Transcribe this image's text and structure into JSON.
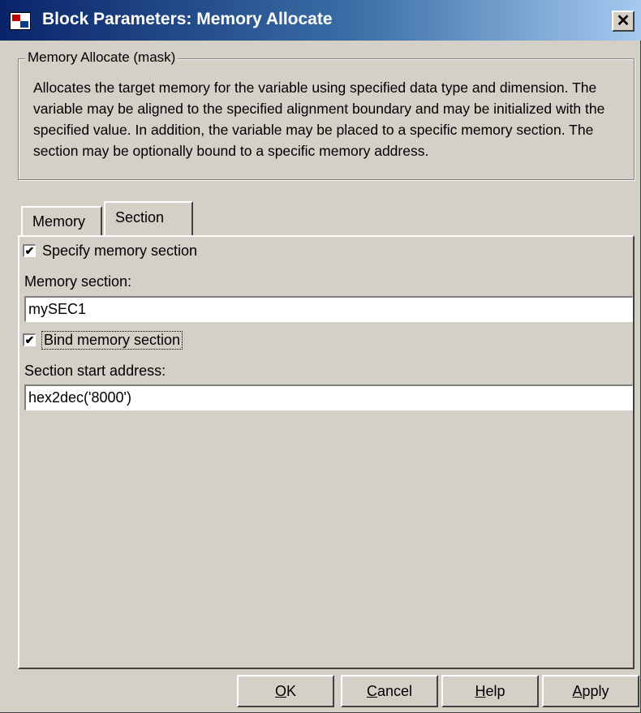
{
  "window": {
    "title": "Block Parameters: Memory Allocate",
    "close_label": "✕"
  },
  "mask": {
    "legend": "Memory Allocate (mask)",
    "description": "Allocates the target memory for the variable using specified data type and dimension. The variable may be aligned to the specified alignment boundary and may be initialized with the specified value. In addition, the variable may be placed to a specific memory section. The section may be optionally bound to a specific memory address."
  },
  "tabs": [
    {
      "label": "Memory",
      "active": false
    },
    {
      "label": "Section",
      "active": true
    }
  ],
  "section_tab": {
    "specify_memory_section": {
      "label": "Specify memory section",
      "checked": true
    },
    "memory_section": {
      "label": "Memory section:",
      "value": "mySEC1"
    },
    "bind_memory_section": {
      "label": "Bind memory section",
      "checked": true
    },
    "section_start_address": {
      "label": "Section start address:",
      "value": "hex2dec('8000')"
    }
  },
  "buttons": {
    "ok": {
      "mnemonic": "O",
      "rest": "K"
    },
    "cancel": {
      "mnemonic": "C",
      "rest": "ancel"
    },
    "help": {
      "mnemonic": "H",
      "rest": "elp"
    },
    "apply": {
      "mnemonic": "A",
      "rest": "pply"
    }
  },
  "check_glyph": "✔"
}
